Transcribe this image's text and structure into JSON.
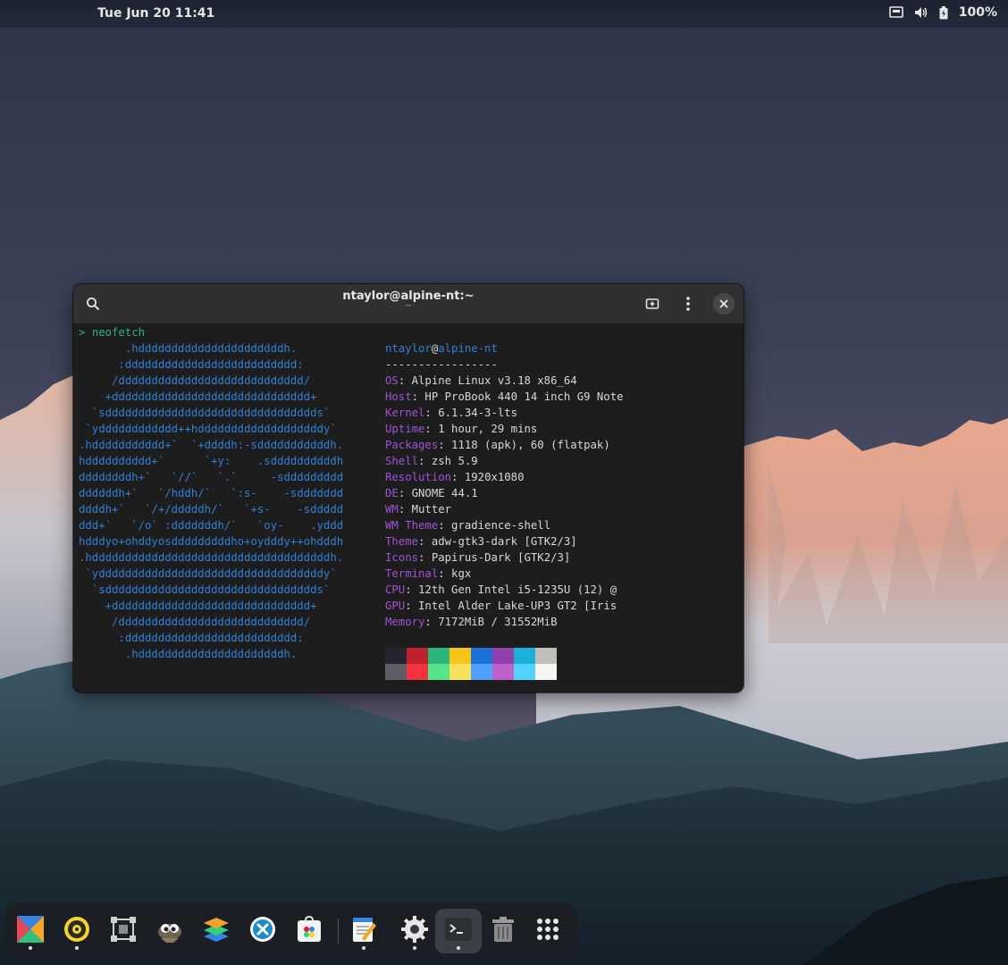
{
  "topbar": {
    "clock": "Tue Jun 20  11:41",
    "battery_percent": "100%",
    "tray_icons": [
      "network-wired-icon",
      "volume-icon",
      "battery-icon"
    ]
  },
  "terminal": {
    "title": "ntaylor@alpine-nt:~",
    "subtitle": "~",
    "buttons": [
      "search-icon",
      "new-tab-icon",
      "menu-icon",
      "close-icon"
    ],
    "prompt_symbol": ">",
    "command": "neofetch",
    "logo_lines": [
      "       .hddddddddddddddddddddddh.",
      "      :dddddddddddddddddddddddddd:",
      "     /dddddddddddddddddddddddddddd/",
      "    +dddddddddddddddddddddddddddddd+",
      "  `sdddddddddddddddddddddddddddddddds`",
      " `ydddddddddddd++hdddddddddddddddddddy`",
      ".hddddddddddd+`  `+ddddh:-sdddddddddddh.",
      "hdddddddddd+`      `+y:    .sddddddddddh",
      "ddddddddh+`   `//`   `.`     -sddddddddd",
      "ddddddh+`   `/hddh/`   `:s-    -sddddddd",
      "ddddh+`   `/+/dddddh/`   `+s-    -sddddd",
      "ddd+`   `/o` :dddddddh/`   `oy-    .yddd",
      "hdddyo+ohddyosdddddddddho+oydddy++ohdddh",
      ".hddddddddddddddddddddddddddddddddddddh.",
      " `yddddddddddddddddddddddddddddddddddy`",
      "  `sdddddddddddddddddddddddddddddddds`",
      "    +dddddddddddddddddddddddddddddd+",
      "     /dddddddddddddddddddddddddddd/",
      "      :dddddddddddddddddddddddddd:",
      "       .hddddddddddddddddddddddh."
    ],
    "user": "ntaylor",
    "at": "@",
    "host": "alpine-nt",
    "separator": "-----------------",
    "info": [
      {
        "label": "OS",
        "value": ": Alpine Linux v3.18 x86_64"
      },
      {
        "label": "Host",
        "value": ": HP ProBook 440 14 inch G9 Note"
      },
      {
        "label": "Kernel",
        "value": ": 6.1.34-3-lts"
      },
      {
        "label": "Uptime",
        "value": ": 1 hour, 29 mins"
      },
      {
        "label": "Packages",
        "value": ": 1118 (apk), 60 (flatpak)"
      },
      {
        "label": "Shell",
        "value": ": zsh 5.9"
      },
      {
        "label": "Resolution",
        "value": ": 1920x1080"
      },
      {
        "label": "DE",
        "value": ": GNOME 44.1"
      },
      {
        "label": "WM",
        "value": ": Mutter"
      },
      {
        "label": "WM Theme",
        "value": ": gradience-shell"
      },
      {
        "label": "Theme",
        "value": ": adw-gtk3-dark [GTK2/3]"
      },
      {
        "label": "Icons",
        "value": ": Papirus-Dark [GTK2/3]"
      },
      {
        "label": "Terminal",
        "value": ": kgx"
      },
      {
        "label": "CPU",
        "value": ": 12th Gen Intel i5-1235U (12) @"
      },
      {
        "label": "GPU",
        "value": ": Intel Alder Lake-UP3 GT2 [Iris"
      },
      {
        "label": "Memory",
        "value": ": 7172MiB / 31552MiB"
      }
    ],
    "palette_top": [
      "#242430",
      "#c0212c",
      "#2bb57a",
      "#f5c518",
      "#1c71d8",
      "#9141ac",
      "#1ab0d8",
      "#c0bfbc"
    ],
    "palette_bottom": [
      "#5e5c64",
      "#f6323e",
      "#57e389",
      "#f8e45c",
      "#51a1ff",
      "#c061cb",
      "#4fd2fd",
      "#f6f5f4"
    ]
  },
  "dock": {
    "items": [
      {
        "name": "tangram-icon",
        "running": true
      },
      {
        "name": "rhythmbox-icon",
        "running": true
      },
      {
        "name": "screenshot-tool-icon",
        "running": false
      },
      {
        "name": "gimp-icon",
        "running": false
      },
      {
        "name": "layers-app-icon",
        "running": false
      },
      {
        "name": "code-editor-icon",
        "running": false
      },
      {
        "name": "software-center-icon",
        "running": false
      },
      {
        "name": "text-editor-icon",
        "running": true
      },
      {
        "name": "settings-icon",
        "running": true
      },
      {
        "name": "terminal-icon",
        "running": true
      },
      {
        "name": "trash-icon",
        "running": false
      },
      {
        "name": "app-grid-icon",
        "running": false
      }
    ]
  }
}
